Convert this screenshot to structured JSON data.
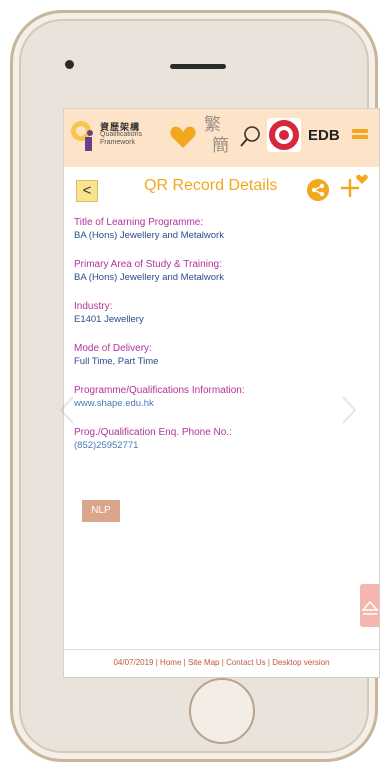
{
  "header": {
    "logo_cn": "資歷架構",
    "logo_en": "Qualifications Framework",
    "lang_trad": "繁",
    "lang_simp": "簡",
    "edb": "EDB"
  },
  "page": {
    "back_label": "<",
    "title": "QR Record Details"
  },
  "fields": [
    {
      "label": "Title of Learning Programme:",
      "value": "BA (Hons) Jewellery and Metalwork"
    },
    {
      "label": "Primary Area of Study & Training:",
      "value": "BA (Hons) Jewellery and Metalwork"
    },
    {
      "label": "Industry:",
      "value": "E1401 Jewellery"
    },
    {
      "label": "Mode of Delivery:",
      "value": "Full Time, Part Time"
    },
    {
      "label": "Programme/Qualifications Information:",
      "value": "www.shape.edu.hk"
    },
    {
      "label": "Prog./Qualification Enq. Phone No.:",
      "value": "(852)25952771"
    }
  ],
  "nlp_label": "NLP",
  "footer": {
    "date": "04/07/2019",
    "home": "Home",
    "sitemap": "Site Map",
    "contact": "Contact Us",
    "desktop": "Desktop version",
    "sep": "|"
  },
  "colors": {
    "accent_orange": "#f2a81e",
    "label_magenta": "#b3329a",
    "value_blue": "#2a4d8c",
    "header_bg": "#fde3c7"
  }
}
